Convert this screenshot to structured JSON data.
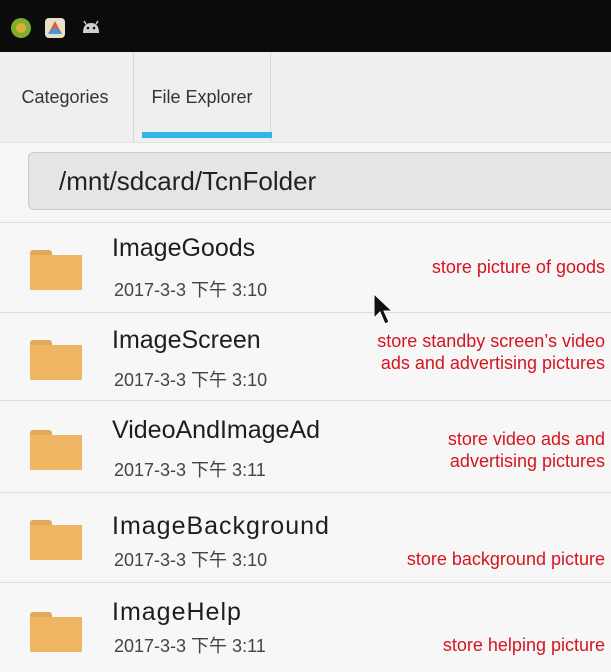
{
  "status_bar": {
    "icons": [
      "green-orb-icon",
      "color-app-icon",
      "android-icon"
    ]
  },
  "tabs": [
    {
      "label": "Categories",
      "active": false
    },
    {
      "label": "File Explorer",
      "active": true
    }
  ],
  "path": "/mnt/sdcard/TcnFolder",
  "files": [
    {
      "name": "ImageGoods",
      "date": "2017-3-3 下午 3:10",
      "note": [
        "store picture of goods"
      ]
    },
    {
      "name": "ImageScreen",
      "date": "2017-3-3 下午 3:10",
      "note": [
        "store standby screen’s video",
        "ads and advertising pictures"
      ]
    },
    {
      "name": "VideoAndImageAd",
      "date": "2017-3-3 下午 3:11",
      "note": [
        "store video ads and",
        "advertising pictures"
      ]
    },
    {
      "name": "ImageBackground",
      "date": "2017-3-3 下午 3:10",
      "note": [
        "store background picture"
      ]
    },
    {
      "name": "ImageHelp",
      "date": "2017-3-3 下午 3:11",
      "note": [
        "store helping picture"
      ]
    }
  ],
  "colors": {
    "tab_indicator": "#33b5e5",
    "folder": "#eeb562",
    "annotation": "#d6141f"
  }
}
